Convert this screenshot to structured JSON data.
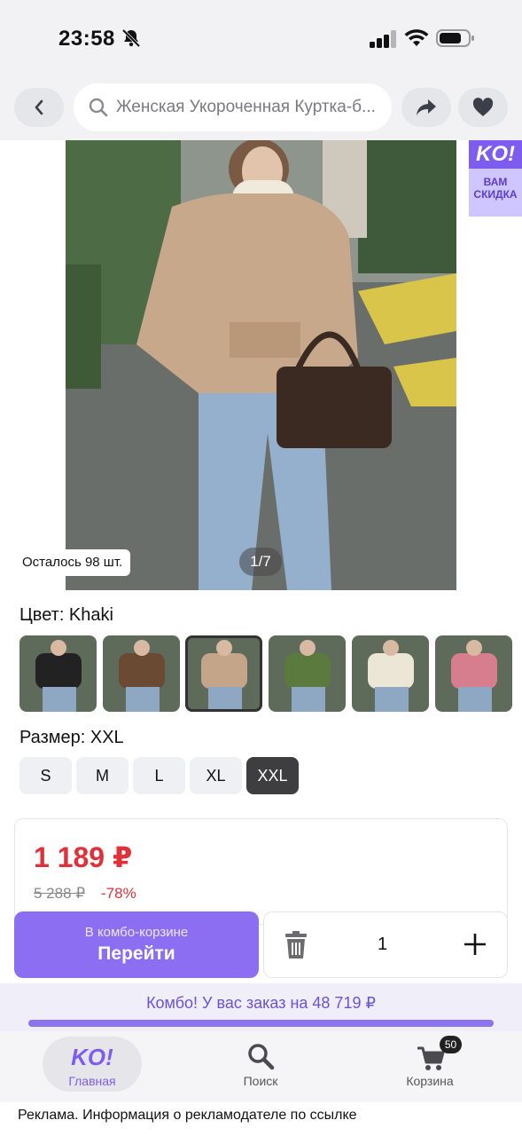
{
  "status": {
    "time": "23:58"
  },
  "header": {
    "search_text": "Женская Укороченная Куртка-б..."
  },
  "gallery": {
    "promo_logo": "KO!",
    "promo_text": "ВАМ СКИДКА",
    "stock": "Осталось 98 шт.",
    "counter": "1/7"
  },
  "color": {
    "label": "Цвет: Khaki",
    "swatches": [
      "black",
      "brown",
      "khaki",
      "green",
      "cream",
      "pink"
    ],
    "selected": "khaki"
  },
  "size": {
    "label": "Размер: XXL",
    "options": [
      "S",
      "M",
      "L",
      "XL",
      "XXL"
    ],
    "selected": "XXL"
  },
  "price": {
    "current": "1 189 ₽",
    "old": "5 288 ₽",
    "discount": "-78%"
  },
  "combo": {
    "subtitle": "В комбо-корзине",
    "action": "Перейти",
    "quantity": "1",
    "bar_text": "Комбо! У вас заказ на 48 719 ₽",
    "progress": 1.0
  },
  "tabs": {
    "home": "Главная",
    "search": "Поиск",
    "cart": "Корзина",
    "cart_badge": "50",
    "home_logo": "KO!"
  },
  "ad": "Реклама. Информация о рекламодателе по ссылке",
  "colors": {
    "accent": "#7e5cf0",
    "price": "#e0303a"
  }
}
